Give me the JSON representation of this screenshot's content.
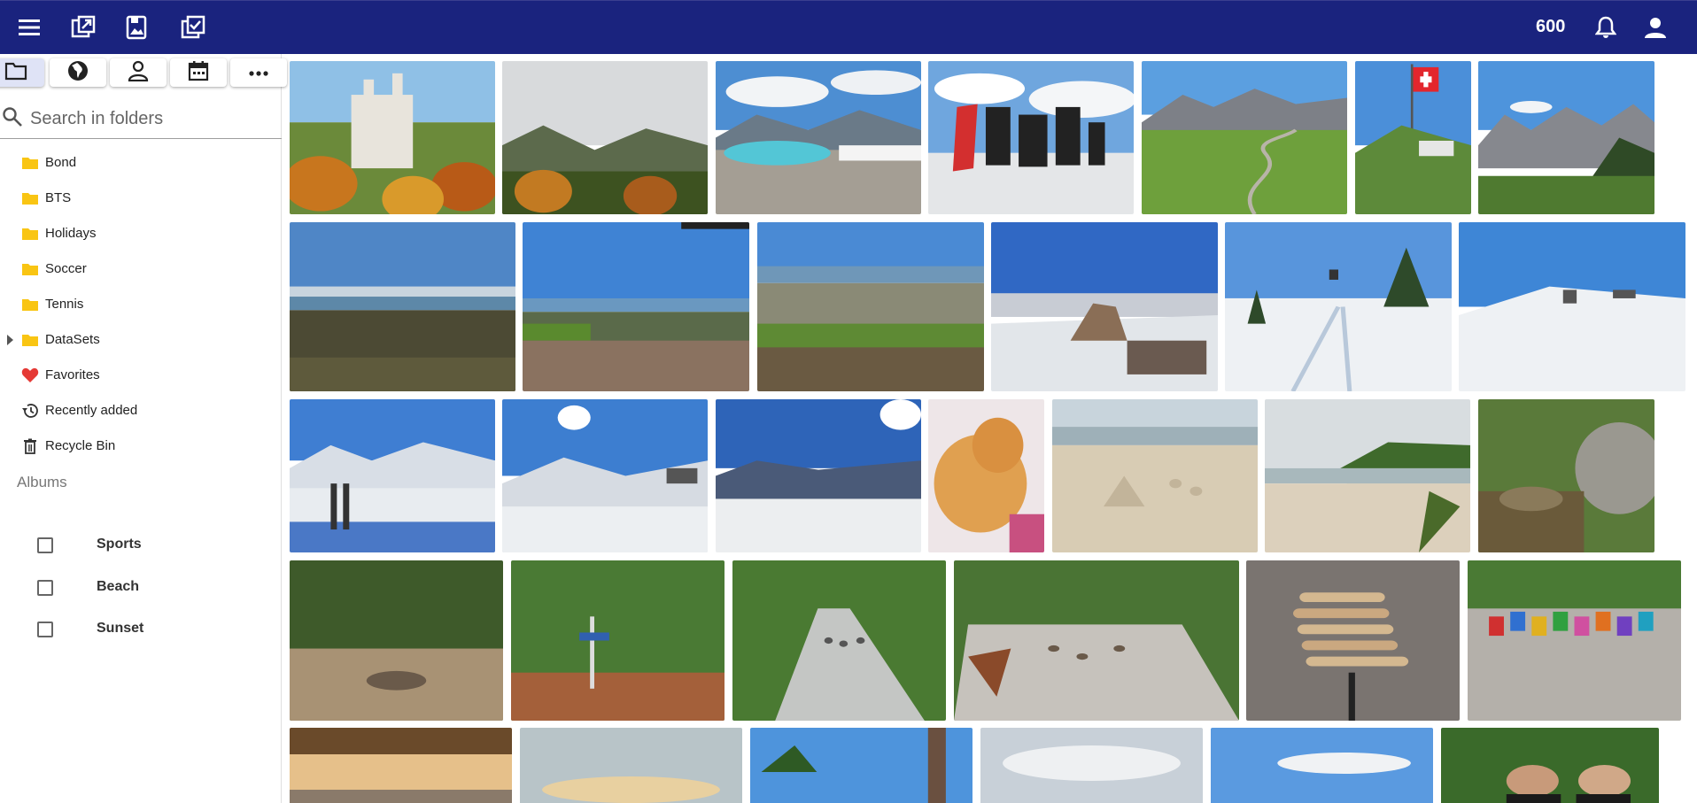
{
  "header": {
    "menu_icon": "hamburger-menu-icon",
    "icons": [
      "open-external-icon",
      "photo-library-icon",
      "select-photos-icon"
    ],
    "count": "600",
    "notifications_icon": "bell-icon",
    "account_icon": "person-icon",
    "bar_color": "#1a237e"
  },
  "sidebar": {
    "tabs": [
      {
        "icon": "folder-icon",
        "active": true
      },
      {
        "icon": "globe-icon"
      },
      {
        "icon": "person-icon"
      },
      {
        "icon": "calendar-icon"
      },
      {
        "icon": "more-horizontal-icon"
      }
    ],
    "search_placeholder": "Search in folders",
    "folders": [
      {
        "label": "Bond",
        "icon": "folder-icon"
      },
      {
        "label": "BTS",
        "icon": "folder-icon"
      },
      {
        "label": "Holidays",
        "icon": "folder-icon"
      },
      {
        "label": "Soccer",
        "icon": "folder-icon"
      },
      {
        "label": "Tennis",
        "icon": "folder-icon"
      },
      {
        "label": "DataSets",
        "icon": "folder-icon",
        "expandable": true
      },
      {
        "label": "Favorites",
        "icon": "heart-icon"
      },
      {
        "label": "Recently added",
        "icon": "history-icon"
      },
      {
        "label": "Recycle Bin",
        "icon": "trash-icon"
      }
    ],
    "albums_title": "Albums",
    "albums": [
      {
        "label": "Sports",
        "checked": false
      },
      {
        "label": "Beach",
        "checked": false
      },
      {
        "label": "Sunset",
        "checked": false
      }
    ]
  },
  "gallery": {
    "photos": [
      "castle",
      "forest-valley",
      "alpine-lake",
      "ischgl-sign",
      "mountain-road",
      "swiss-flag-peak",
      "alpine-ridge",
      "lake-view",
      "lake-panorama",
      "city-lake",
      "snowy-rocks",
      "ski-lift-trees",
      "ski-slope",
      "snowy-range",
      "sunburst-snow",
      "snow-sun",
      "cat-sleeping",
      "sandcastle",
      "tropical-beach",
      "jungle-stream",
      "jungle-clearing",
      "trail-sign",
      "jungle-road",
      "monkeys-road",
      "bamboo-sticks",
      "kohphangan-sign",
      "beach-hut-sunset",
      "sunset-sky",
      "palm-trees",
      "cloudy-sea",
      "blue-sky",
      "portrait-pair"
    ]
  }
}
